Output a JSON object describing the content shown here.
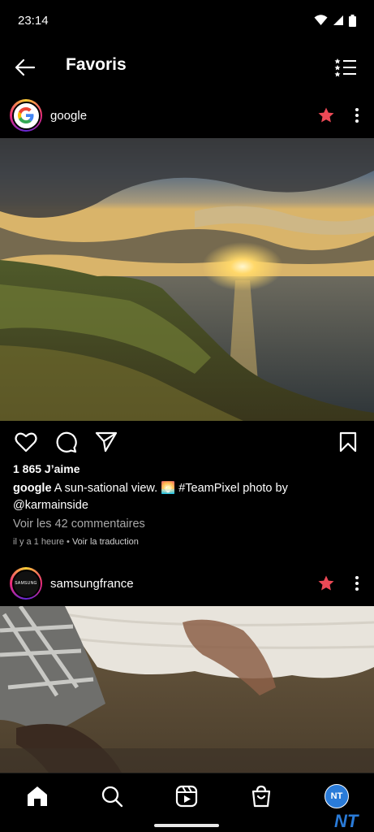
{
  "status_bar": {
    "time": "23:14"
  },
  "header": {
    "title": "Favoris"
  },
  "posts": [
    {
      "username": "google",
      "avatar_text": "G",
      "likes": "1 865 J’aime",
      "caption_user": "google",
      "caption_text": "A sun-sational view. 🌅 #TeamPixel photo by @karmainside",
      "comments": "Voir les 42 commentaires",
      "time": "il y a 1 heure",
      "separator": " • ",
      "translate": "Voir la traduction"
    },
    {
      "username": "samsungfrance",
      "avatar_text": "SAMSUNG"
    }
  ],
  "bottom_nav": {
    "profile_initials": "NT"
  },
  "watermark": "NT",
  "colors": {
    "star": "#ed4956",
    "profile": "#2a7bd8",
    "secondary_text": "#a8a8a8"
  }
}
